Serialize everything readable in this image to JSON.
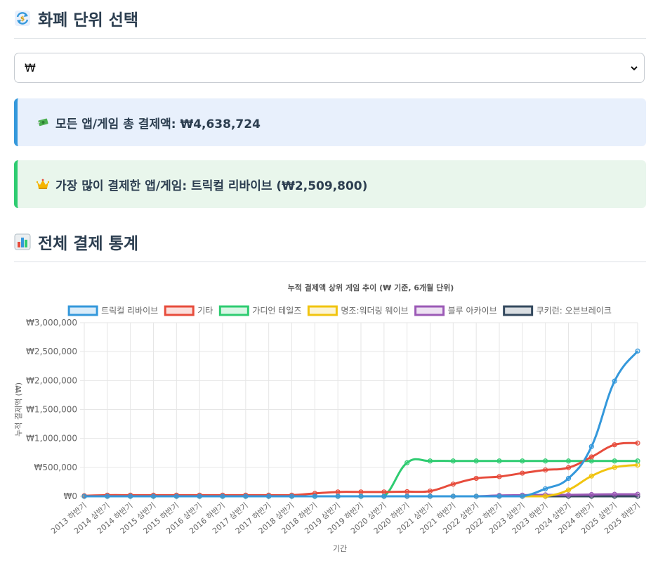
{
  "currency_section": {
    "title": "화폐 단위 선택",
    "icon": "currency-exchange-icon",
    "selected_currency": "₩"
  },
  "summary": {
    "total_text": "모든 앱/게임 총 결제액: ₩4,638,724",
    "total_icon": "money-wings-icon",
    "top_text": "가장 많이 결제한 앱/게임: 트릭컬 리바이브 (₩2,509,800)",
    "top_icon": "crown-icon"
  },
  "stats_section": {
    "title": "전체 결제 통계",
    "icon": "bar-chart-icon"
  },
  "chart_data": {
    "type": "line",
    "title": "누적 결제액 상위 게임 추이 (₩ 기준, 6개월 단위)",
    "xlabel": "기간",
    "ylabel": "누적 결제액 (₩)",
    "ylim": [
      0,
      3000000
    ],
    "yticks": [
      "₩0",
      "₩500,000",
      "₩1,000,000",
      "₩1,500,000",
      "₩2,000,000",
      "₩2,500,000",
      "₩3,000,000"
    ],
    "grid": true,
    "legend_position": "top",
    "categories": [
      "2013 하반기",
      "2014 상반기",
      "2014 하반기",
      "2015 상반기",
      "2015 하반기",
      "2016 상반기",
      "2016 하반기",
      "2017 상반기",
      "2017 하반기",
      "2018 상반기",
      "2018 하반기",
      "2019 상반기",
      "2019 하반기",
      "2020 상반기",
      "2020 하반기",
      "2021 상반기",
      "2021 하반기",
      "2022 상반기",
      "2022 하반기",
      "2023 상반기",
      "2023 하반기",
      "2024 상반기",
      "2024 하반기",
      "2025 상반기",
      "2025 하반기"
    ],
    "series": [
      {
        "name": "트릭컬 리바이브",
        "color": "#3498db",
        "values": [
          0,
          0,
          0,
          0,
          0,
          0,
          0,
          0,
          0,
          0,
          0,
          0,
          0,
          0,
          0,
          0,
          0,
          0,
          0,
          0,
          130000,
          310000,
          860000,
          1990000,
          2509800
        ]
      },
      {
        "name": "기타",
        "color": "#e74c3c",
        "values": [
          10000,
          20000,
          20000,
          20000,
          20000,
          20000,
          20000,
          20000,
          20000,
          20000,
          50000,
          75000,
          75000,
          75000,
          80000,
          90000,
          210000,
          310000,
          340000,
          400000,
          455000,
          495000,
          680000,
          890000,
          920000
        ]
      },
      {
        "name": "가디언 테일즈",
        "color": "#2ecc71",
        "values": [
          0,
          0,
          0,
          0,
          0,
          0,
          0,
          0,
          0,
          0,
          0,
          0,
          0,
          0,
          580000,
          610000,
          610000,
          610000,
          610000,
          610000,
          610000,
          610000,
          610000,
          610000,
          610000
        ]
      },
      {
        "name": "명조:워더링 웨이브",
        "color": "#f1c40f",
        "values": [
          0,
          0,
          0,
          0,
          0,
          0,
          0,
          0,
          0,
          0,
          0,
          0,
          0,
          0,
          0,
          0,
          0,
          0,
          0,
          0,
          0,
          110000,
          350000,
          500000,
          540000
        ]
      },
      {
        "name": "블루 아카이브",
        "color": "#9b59b6",
        "values": [
          0,
          0,
          0,
          0,
          0,
          0,
          0,
          0,
          0,
          0,
          0,
          0,
          0,
          0,
          0,
          0,
          0,
          0,
          15000,
          20000,
          25000,
          25000,
          30000,
          35000,
          35000
        ]
      },
      {
        "name": "쿠키런: 오븐브레이크",
        "color": "#34495e",
        "values": [
          0,
          0,
          0,
          0,
          0,
          0,
          0,
          0,
          0,
          0,
          0,
          0,
          0,
          0,
          0,
          0,
          0,
          0,
          0,
          0,
          0,
          0,
          0,
          0,
          0
        ]
      }
    ]
  }
}
